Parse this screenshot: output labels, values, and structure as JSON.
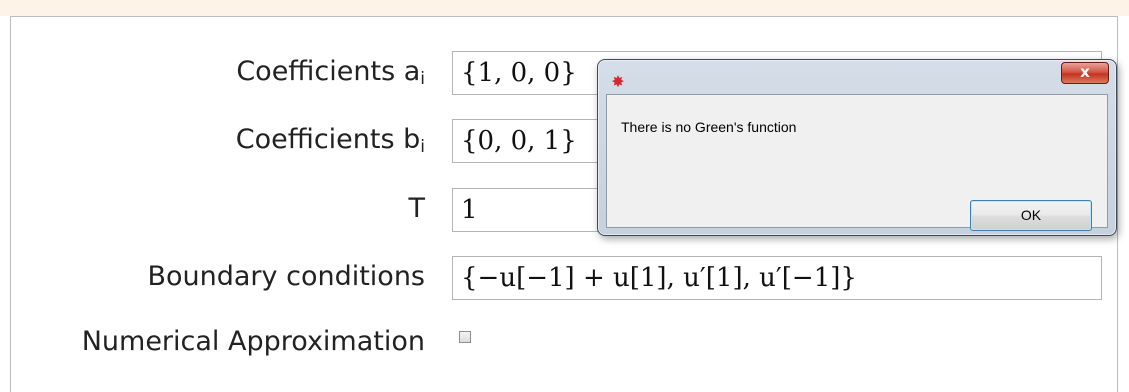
{
  "form": {
    "coefficients_a": {
      "label": "Coefficients a",
      "label_sub": "i",
      "value": "{1, 0, 0}"
    },
    "coefficients_b": {
      "label": "Coefficients b",
      "label_sub": "i",
      "value": "{0, 0, 1}"
    },
    "t": {
      "label": "T",
      "value": "1"
    },
    "boundary_conditions": {
      "label": "Boundary conditions",
      "value": "{−u[−1] + u[1], u′[1], u′[−1]}"
    },
    "numerical_approximation": {
      "label": "Numerical Approximation",
      "checked": false
    }
  },
  "dialog": {
    "icon": "mathematica-spikey-icon",
    "close_label": "x",
    "message": "There is no Green's function",
    "ok_label": "OK"
  }
}
